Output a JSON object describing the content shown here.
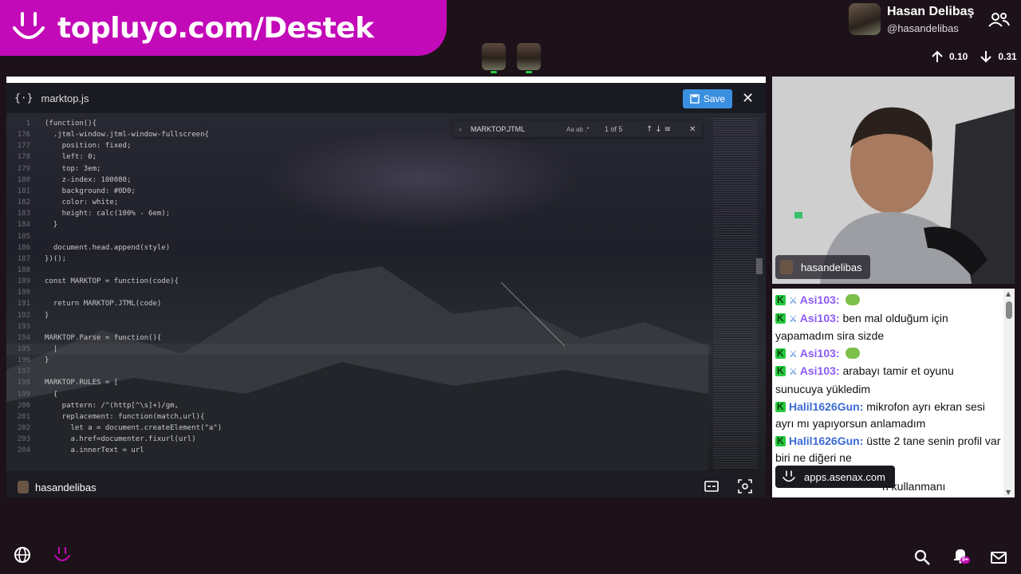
{
  "banner": {
    "text": "topluyo.com/Destek",
    "logo_icon": "smile-logo-icon"
  },
  "profile": {
    "name": "Hasan Delibaş",
    "handle": "@hasandelibas"
  },
  "stats": {
    "up": "0.10",
    "down": "0.31"
  },
  "editor": {
    "file_icon": "{·}",
    "file_name": "marktop.js",
    "save_label": "Save",
    "close_glyph": "✕",
    "find": {
      "query": "MARKTOP.JTML",
      "options": "Aa  ab  .*",
      "count": "1 of 5",
      "arrows": "↑↓≡",
      "close": "✕"
    },
    "lines": [
      {
        "n": "1",
        "t": "(function(){"
      },
      {
        "n": "176",
        "t": "  .jtml-window.jtml-window-fullscreen{"
      },
      {
        "n": "177",
        "t": "    position: fixed;"
      },
      {
        "n": "178",
        "t": "    left: 0;"
      },
      {
        "n": "179",
        "t": "    top: 3em;"
      },
      {
        "n": "180",
        "t": "    z-index: 100080;"
      },
      {
        "n": "181",
        "t": "    background: #0D0;"
      },
      {
        "n": "182",
        "t": "    color: white;"
      },
      {
        "n": "183",
        "t": "    height: calc(100% - 6em);"
      },
      {
        "n": "184",
        "t": "  }"
      },
      {
        "n": "185",
        "t": ""
      },
      {
        "n": "186",
        "t": "  document.head.append(style)"
      },
      {
        "n": "187",
        "t": "})();"
      },
      {
        "n": "188",
        "t": ""
      },
      {
        "n": "189",
        "t": "const MARKTOP = function(code){"
      },
      {
        "n": "190",
        "t": ""
      },
      {
        "n": "191",
        "t": "  return MARKTOP.JTML(code)"
      },
      {
        "n": "192",
        "t": "}"
      },
      {
        "n": "193",
        "t": ""
      },
      {
        "n": "194",
        "t": "MARKTOP.Parse = function(){"
      },
      {
        "n": "195",
        "t": "  |"
      },
      {
        "n": "196",
        "t": "}"
      },
      {
        "n": "197",
        "t": ""
      },
      {
        "n": "198",
        "t": "MARKTOP.RULES = ["
      },
      {
        "n": "199",
        "t": "  {"
      },
      {
        "n": "200",
        "t": "    pattern: /^(http[^\\s]+)/gm,"
      },
      {
        "n": "201",
        "t": "    replacement: function(match,url){"
      },
      {
        "n": "202",
        "t": "      let a = document.createElement(\"a\")"
      },
      {
        "n": "203",
        "t": "      a.href=documenter.fixurl(url)"
      },
      {
        "n": "204",
        "t": "      a.innerText = url"
      }
    ],
    "footer_user": "hasandelibas"
  },
  "webcam": {
    "label": "hasandelibas"
  },
  "chat": {
    "messages": [
      {
        "user": "Asi103",
        "color": "asi",
        "sword": true,
        "text": "",
        "emote": true
      },
      {
        "user": "Asi103",
        "color": "asi",
        "sword": true,
        "text": "ben mal olduğum için yapamadım sira sizde",
        "emote": false
      },
      {
        "user": "Asi103",
        "color": "asi",
        "sword": true,
        "text": "",
        "emote": true
      },
      {
        "user": "Asi103",
        "color": "asi",
        "sword": true,
        "text": "arabayı tamir et oyunu sunucuya yükledim",
        "emote": false
      },
      {
        "user": "Halil1626Gun",
        "color": "halil",
        "sword": false,
        "text": "mikrofon ayrı ekran sesi ayrı mı yapıyorsun anlamadım",
        "emote": false
      },
      {
        "user": "Halil1626Gun",
        "color": "halil",
        "sword": false,
        "text": "üstte 2 tane senin profil var biri ne diğeri ne",
        "emote": false
      }
    ],
    "overlay_text": "apps.asenax.com",
    "partial_text": "n kullanmanı"
  },
  "colors": {
    "accent": "#c30ab8",
    "save": "#3b8fe0",
    "asi": "#8b5cf6",
    "halil": "#3a6ad5",
    "mod_badge": "#27c93f"
  }
}
